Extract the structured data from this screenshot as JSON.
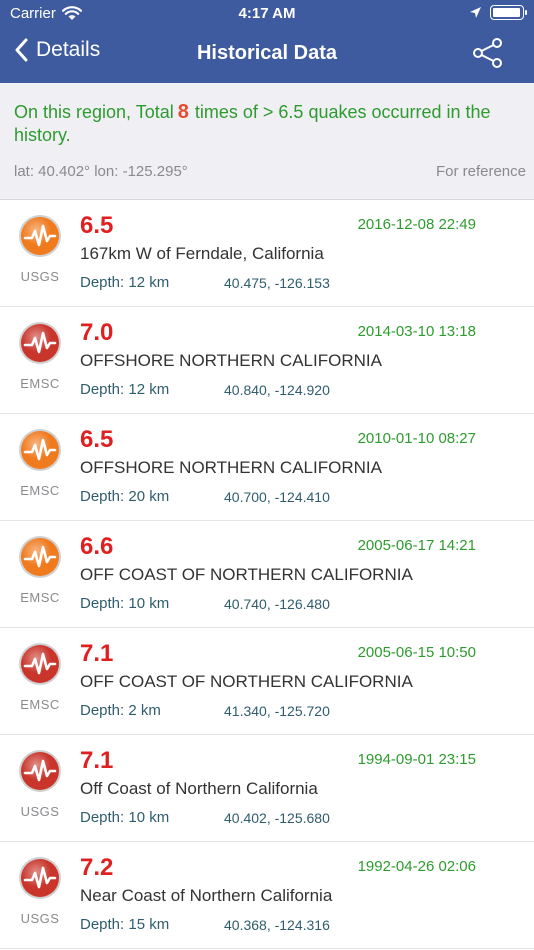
{
  "status": {
    "carrier": "Carrier",
    "time": "4:17 AM",
    "battery_level": 0.95
  },
  "nav": {
    "back_label": "Details",
    "title": "Historical Data"
  },
  "summary": {
    "text_before": "On this region, Total",
    "count": "8",
    "text_after": "times of > 6.5 quakes occurred in the history.",
    "coords": "lat: 40.402°   lon: -125.295°",
    "reference": "For reference"
  },
  "colors": {
    "header": "#3d5b9e",
    "orange_quake": "#f07a1e",
    "red_quake": "#c9352b",
    "green_text": "#2e9b2e",
    "mag_red": "#e02020"
  },
  "quakes": [
    {
      "mag": "6.5",
      "date": "2016-12-08 22:49",
      "place": "167km W of Ferndale, California",
      "depth": "Depth: 12 km",
      "loc": "40.475, -126.153",
      "source": "USGS",
      "level": "orange"
    },
    {
      "mag": "7.0",
      "date": "2014-03-10 13:18",
      "place": "OFFSHORE NORTHERN CALIFORNIA",
      "depth": "Depth: 12 km",
      "loc": "40.840, -124.920",
      "source": "EMSC",
      "level": "red"
    },
    {
      "mag": "6.5",
      "date": "2010-01-10 08:27",
      "place": "OFFSHORE NORTHERN CALIFORNIA",
      "depth": "Depth: 20 km",
      "loc": "40.700, -124.410",
      "source": "EMSC",
      "level": "orange"
    },
    {
      "mag": "6.6",
      "date": "2005-06-17 14:21",
      "place": "OFF COAST OF NORTHERN CALIFORNIA",
      "depth": "Depth: 10 km",
      "loc": "40.740, -126.480",
      "source": "EMSC",
      "level": "orange"
    },
    {
      "mag": "7.1",
      "date": "2005-06-15 10:50",
      "place": "OFF COAST OF NORTHERN CALIFORNIA",
      "depth": "Depth: 2 km",
      "loc": "41.340, -125.720",
      "source": "EMSC",
      "level": "red"
    },
    {
      "mag": "7.1",
      "date": "1994-09-01 23:15",
      "place": "Off Coast of Northern California",
      "depth": "Depth: 10 km",
      "loc": "40.402, -125.680",
      "source": "USGS",
      "level": "red"
    },
    {
      "mag": "7.2",
      "date": "1992-04-26 02:06",
      "place": "Near Coast of Northern California",
      "depth": "Depth: 15 km",
      "loc": "40.368, -124.316",
      "source": "USGS",
      "level": "red"
    }
  ]
}
